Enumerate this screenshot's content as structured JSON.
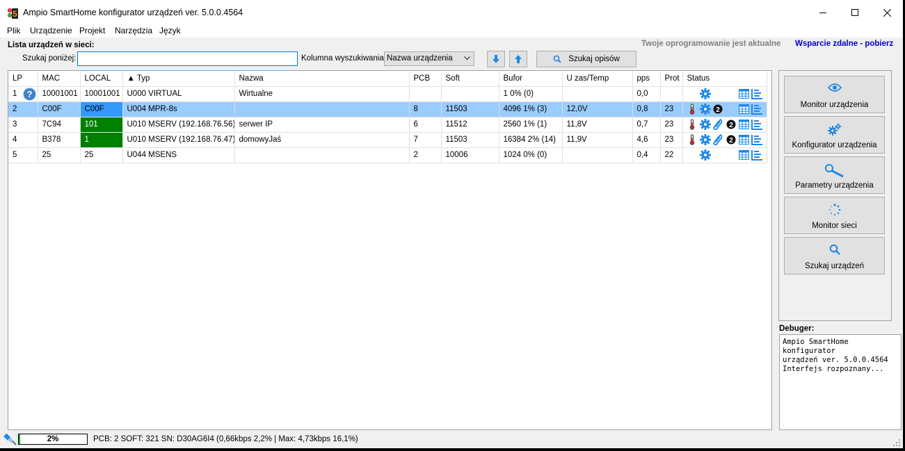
{
  "window": {
    "title": "Ampio SmartHome konfigurator urządzeń ver. 5.0.0.4564",
    "icon": "ampio-logo-icon"
  },
  "menu": [
    "Plik",
    "Urządzenie",
    "Projekt",
    "Narzędzia",
    "Język"
  ],
  "header": {
    "list_title": "Lista urządzeń w sieci:",
    "update_status": "Twoje oprogramowanie jest aktualne",
    "remote_support": "Wsparcie zdalne - pobierz"
  },
  "search": {
    "label": "Szukaj poniżej:",
    "value": "",
    "placeholder": "",
    "column_label": "Kolumna wyszukiwania:",
    "column_selected": "Nazwa urządzenia",
    "search_desc_label": "Szukaj opisów"
  },
  "table": {
    "columns": [
      "LP",
      "MAC",
      "LOCAL",
      "▲ Typ",
      "Nazwa",
      "PCB",
      "Soft",
      "Bufor",
      "U zas/Temp",
      "pps",
      "Prot",
      "Status"
    ],
    "rows": [
      {
        "lp": "1",
        "mac": "10001001",
        "local": "10001001",
        "typ": "U000 VIRTUAL",
        "nazwa": "Wirtualne",
        "pcb": "",
        "soft": "",
        "bufor": "1 0% (0)",
        "uzas": "",
        "pps": "0,0",
        "prot": "",
        "status": [
          "",
          "gear-icon",
          "",
          "",
          "table-icon",
          "list-icon"
        ],
        "help": true,
        "selected": false,
        "local_green": false
      },
      {
        "lp": "2",
        "mac": "C00F",
        "local": "C00F",
        "typ": "U004 MPR-8s",
        "nazwa": "",
        "pcb": "8",
        "soft": "11503",
        "bufor": "4096 1% (3)",
        "uzas": "12,0V",
        "pps": "0,8",
        "prot": "23",
        "status": [
          "thermometer-icon",
          "gear-icon",
          "number-2-icon",
          "",
          "table-icon",
          "list-icon"
        ],
        "help": false,
        "selected": true,
        "local_green": false
      },
      {
        "lp": "3",
        "mac": "7C94",
        "local": "101",
        "typ": "U010 MSERV (192.168.76.56)",
        "nazwa": "serwer IP",
        "pcb": "6",
        "soft": "11512",
        "bufor": "2560 1% (1)",
        "uzas": "11,8V",
        "pps": "0,7",
        "prot": "23",
        "status": [
          "thermometer-icon",
          "gear-icon",
          "link-icon",
          "number-2-icon",
          "table-icon",
          "list-icon"
        ],
        "help": false,
        "selected": false,
        "local_green": true
      },
      {
        "lp": "4",
        "mac": "B378",
        "local": "1",
        "typ": "U010 MSERV (192.168.76.47)",
        "nazwa": "domowyJaś",
        "pcb": "7",
        "soft": "11503",
        "bufor": "16384 2% (14)",
        "uzas": "11,9V",
        "pps": "4,6",
        "prot": "23",
        "status": [
          "thermometer-icon",
          "gear-icon",
          "link-icon",
          "number-2-icon",
          "table-icon",
          "list-icon"
        ],
        "help": false,
        "selected": false,
        "local_green": true
      },
      {
        "lp": "5",
        "mac": "25",
        "local": "25",
        "typ": "U044 MSENS",
        "nazwa": "",
        "pcb": "2",
        "soft": "10006",
        "bufor": "1024 0% (0)",
        "uzas": "",
        "pps": "0,4",
        "prot": "22",
        "status": [
          "",
          "gear-icon",
          "",
          "",
          "table-icon",
          "list-icon"
        ],
        "help": false,
        "selected": false,
        "local_green": false
      }
    ]
  },
  "tools": [
    {
      "label": "Monitor urządzenia",
      "icon": "eye-icon"
    },
    {
      "label": "Konfigurator urządzenia",
      "icon": "gears-icon"
    },
    {
      "label": "Parametry urządzenia",
      "icon": "wrench-icon"
    },
    {
      "label": "Monitor sieci",
      "icon": "spinner-icon"
    },
    {
      "label": "Szukaj urządzeń",
      "icon": "search-icon"
    }
  ],
  "debug": {
    "label": "Debuger:",
    "text": "Ampio SmartHome konfigurator\nurządzeń ver. 5.0.0.4564\nInterfejs rozpoznany..."
  },
  "statusbar": {
    "progress": 2,
    "progress_label": "2%",
    "text": "PCB: 2 SOFT: 321 SN: D30AG6I4 (0,66kbps 2,2% | Max: 4,73kbps 16,1%)"
  },
  "colors": {
    "accent": "#0078d7",
    "selection": "#99ccff",
    "local_green": "#008000",
    "link_blue": "#0000cc",
    "icon_blue": "#1e88e5"
  }
}
